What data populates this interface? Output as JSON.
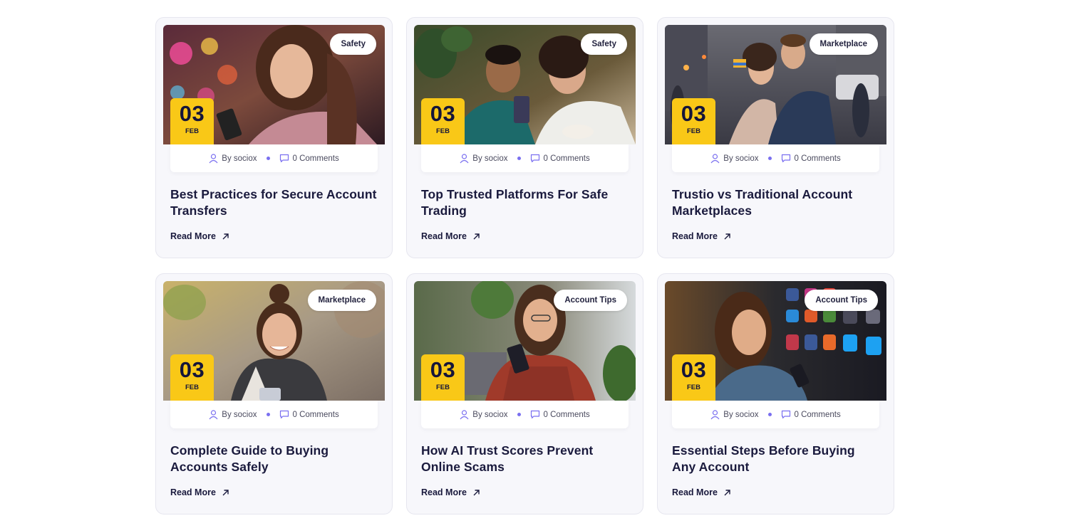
{
  "posts": [
    {
      "category": "Safety",
      "day": "03",
      "month": "FEB",
      "author": "By sociox",
      "comments": "0 Comments",
      "title": "Best Practices for Secure Account Transfers",
      "read_more": "Read More"
    },
    {
      "category": "Safety",
      "day": "03",
      "month": "FEB",
      "author": "By sociox",
      "comments": "0 Comments",
      "title": "Top Trusted Platforms For Safe Trading",
      "read_more": "Read More"
    },
    {
      "category": "Marketplace",
      "day": "03",
      "month": "FEB",
      "author": "By sociox",
      "comments": "0 Comments",
      "title": "Trustio vs Traditional Account Marketplaces",
      "read_more": "Read More"
    },
    {
      "category": "Marketplace",
      "day": "03",
      "month": "FEB",
      "author": "By sociox",
      "comments": "0 Comments",
      "title": "Complete Guide to Buying Accounts Safely",
      "read_more": "Read More"
    },
    {
      "category": "Account Tips",
      "day": "03",
      "month": "FEB",
      "author": "By sociox",
      "comments": "0 Comments",
      "title": "How AI Trust Scores Prevent Online Scams",
      "read_more": "Read More"
    },
    {
      "category": "Account Tips",
      "day": "03",
      "month": "FEB",
      "author": "By sociox",
      "comments": "0 Comments",
      "title": "Essential Steps Before Buying Any Account",
      "read_more": "Read More"
    }
  ],
  "colors": {
    "date_badge": "#f9c817",
    "meta_dot": "#7a6ff0",
    "title_text": "#1a1a3d",
    "card_bg": "#f7f7fb"
  },
  "icons": {
    "author": "user-icon",
    "comments": "comment-icon",
    "read_more": "arrow-up-right-icon"
  }
}
